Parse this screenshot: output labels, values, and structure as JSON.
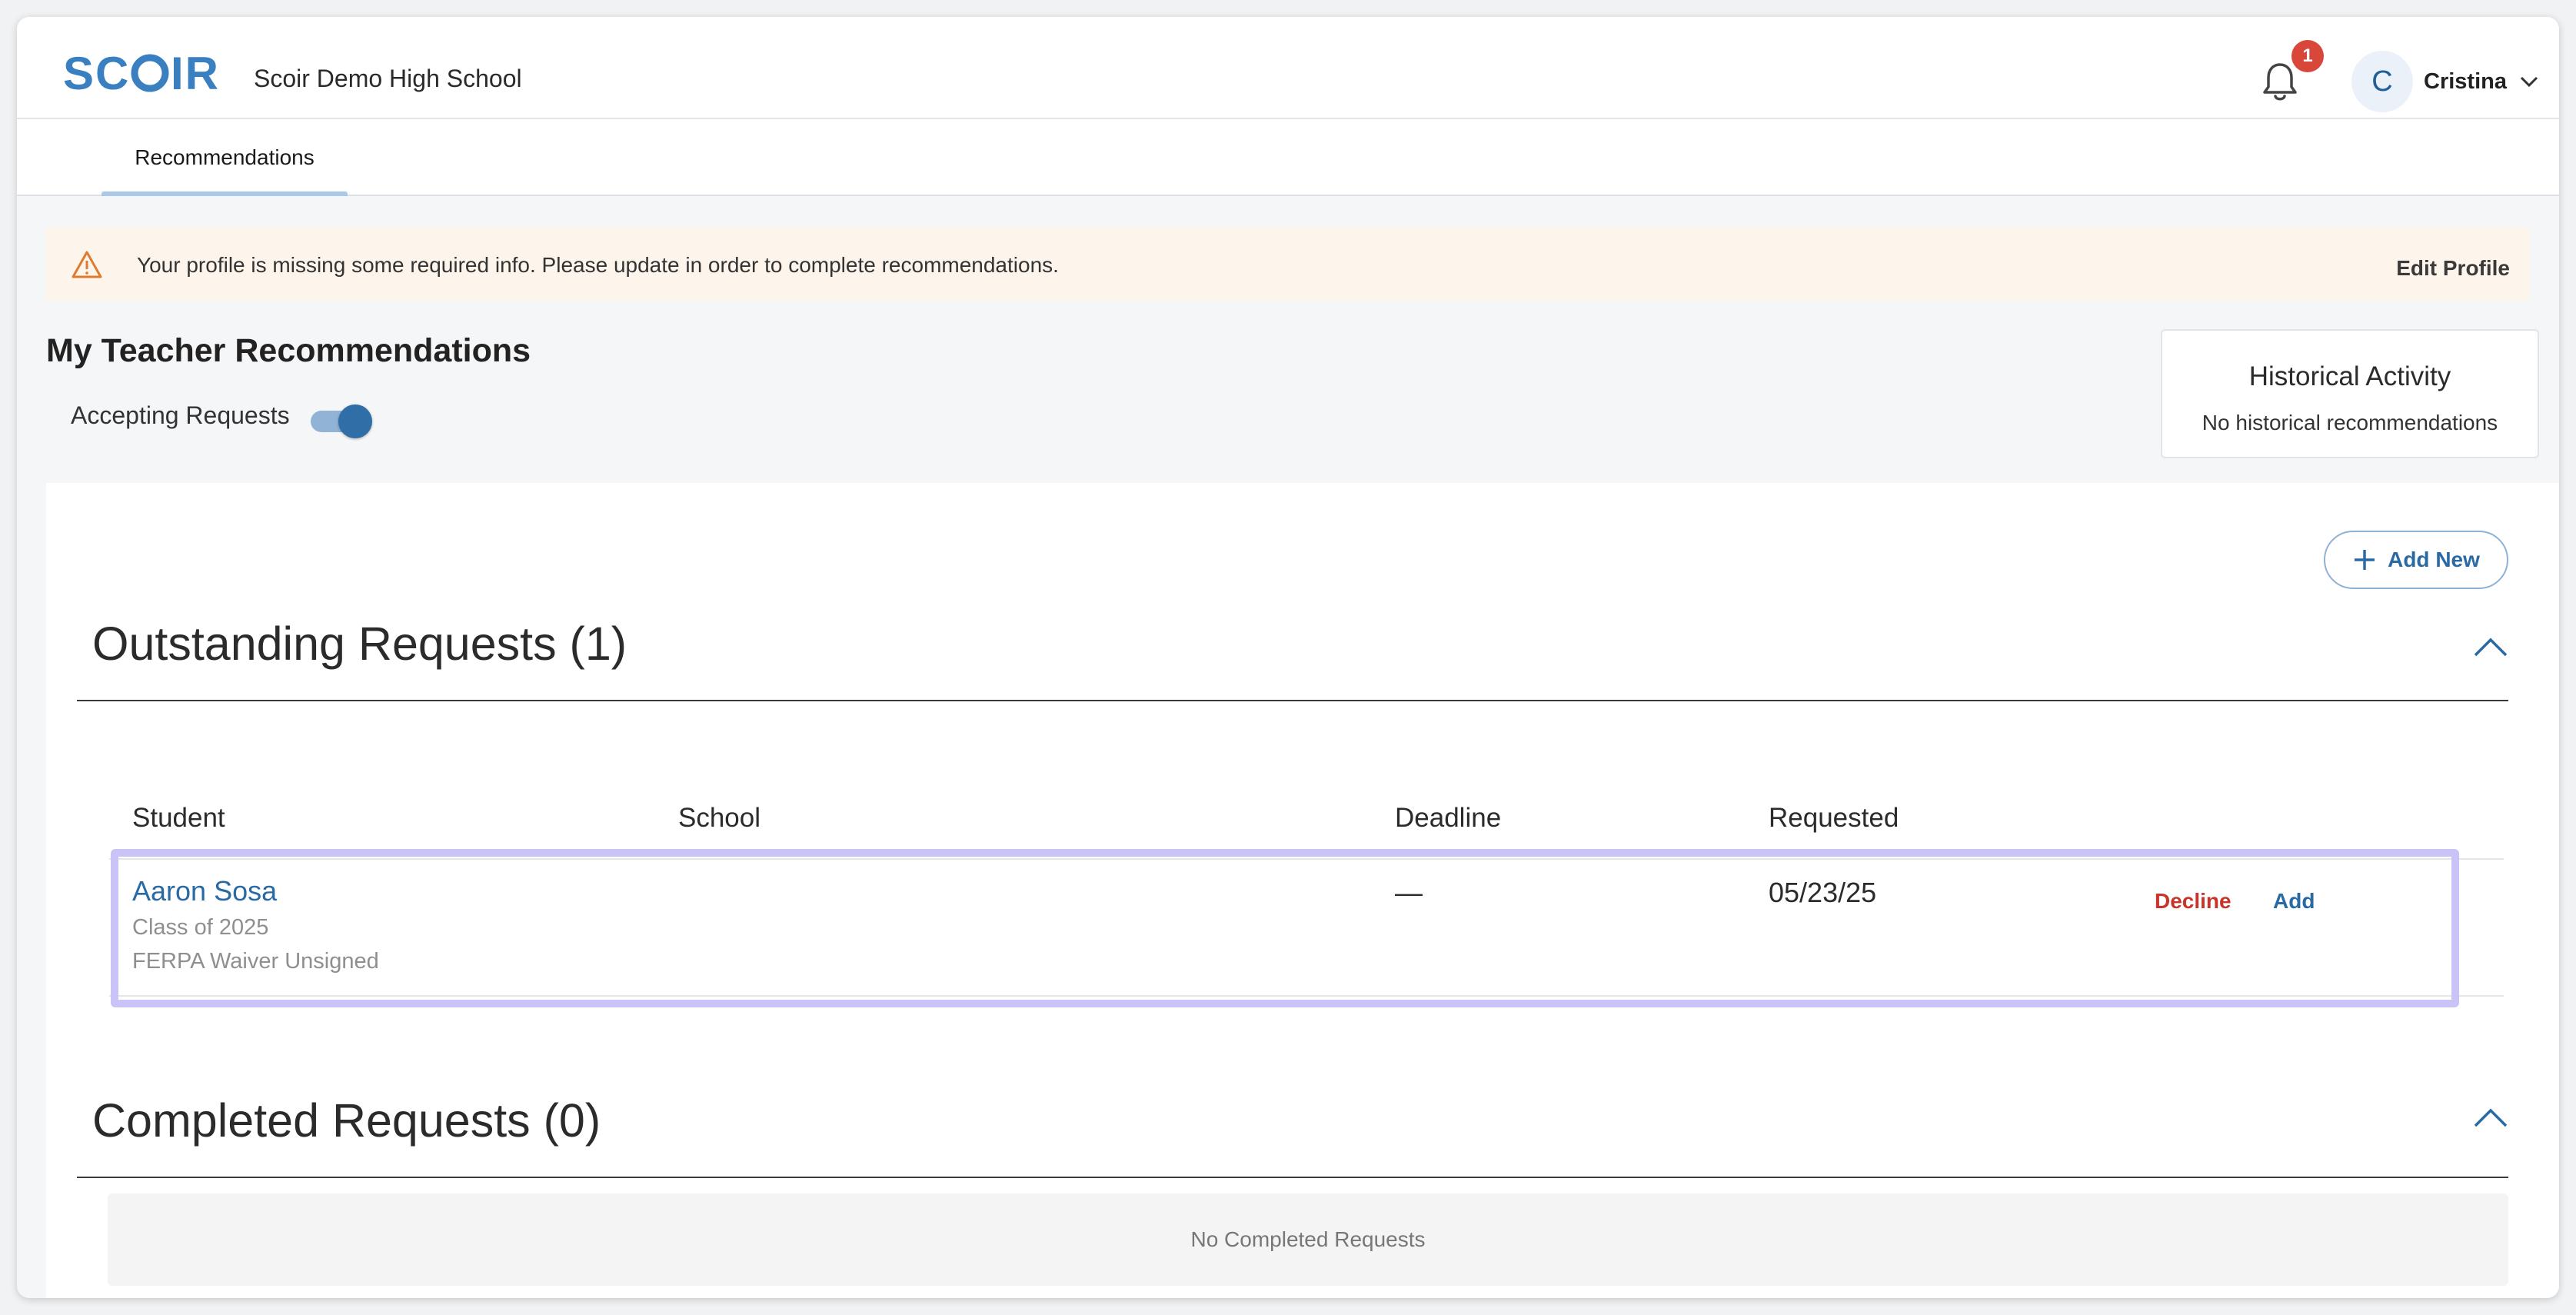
{
  "brand": {
    "logo_text": "SCOIR",
    "school_name": "Scoir Demo High School",
    "accent_color": "#3a7fc0"
  },
  "header": {
    "notification_count": "1",
    "avatar_initial": "C",
    "user_name": "Cristina"
  },
  "tabs": [
    {
      "label": "Recommendations",
      "active": true
    }
  ],
  "alert": {
    "message": "Your profile is missing some required info. Please update in order to complete recommendations.",
    "action_label": "Edit Profile",
    "icon": "warning-icon"
  },
  "page": {
    "title": "My Teacher Recommendations",
    "accepting_label": "Accepting Requests",
    "accepting_enabled": true
  },
  "historical": {
    "title": "Historical Activity",
    "subtitle": "No historical recommendations"
  },
  "actions": {
    "add_new_label": "Add New"
  },
  "outstanding": {
    "title": "Outstanding Requests (1)",
    "columns": [
      "Student",
      "School",
      "Deadline",
      "Requested"
    ],
    "rows": [
      {
        "student_name": "Aaron Sosa",
        "class_year": "Class of 2025",
        "ferpa": "FERPA Waiver Unsigned",
        "school": "",
        "deadline": "—",
        "requested": "05/23/25",
        "decline_label": "Decline",
        "add_label": "Add"
      }
    ]
  },
  "completed": {
    "title": "Completed Requests (0)",
    "empty_message": "No Completed Requests"
  }
}
